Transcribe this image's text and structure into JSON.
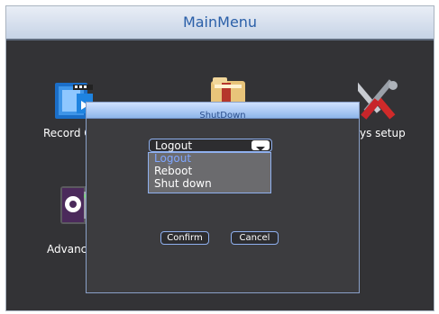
{
  "window": {
    "title": "MainMenu"
  },
  "main": {
    "icons": [
      {
        "label": "Record Q",
        "icon": "record-icon"
      },
      {
        "label": "",
        "icon": "folder-icon"
      },
      {
        "label": "ys setup",
        "icon": "sys-setup-icon"
      },
      {
        "label": "Advance O",
        "icon": "advance-icon"
      }
    ]
  },
  "dialog": {
    "title": "ShutDown",
    "select": {
      "value": "Logout",
      "options": [
        "Logout",
        "Reboot",
        "Shut down"
      ],
      "highlighted": "Logout"
    },
    "confirm_label": "Confirm",
    "cancel_label": "Cancel"
  },
  "colors": {
    "title_text": "#2a5fa8",
    "dialog_title_bg": "#a8c8f2",
    "highlight_text": "#7fa6ff"
  }
}
